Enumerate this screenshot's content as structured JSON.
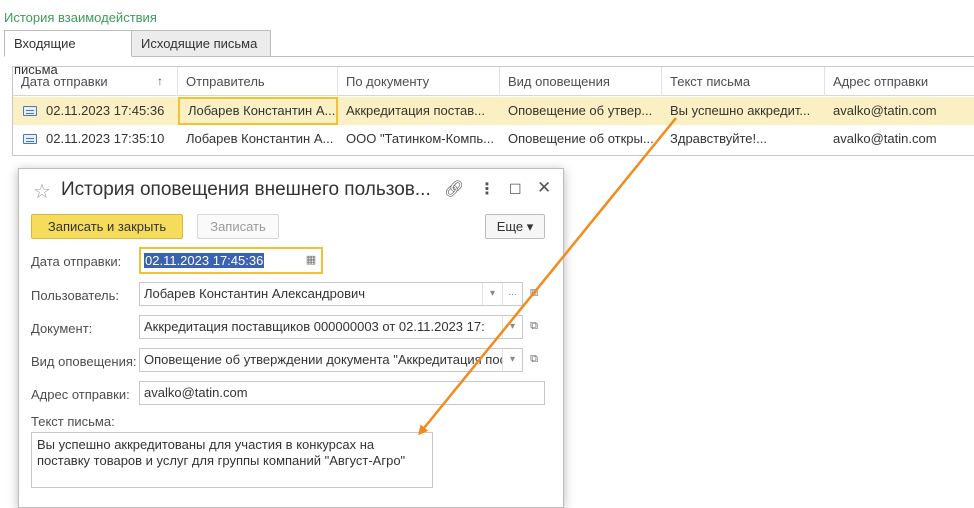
{
  "section_title": "История взаимодействия",
  "tabs": [
    {
      "label": "Входящие письма",
      "active": true
    },
    {
      "label": "Исходящие письма",
      "active": false
    }
  ],
  "table": {
    "columns": [
      "Дата отправки",
      "Отправитель",
      "По документу",
      "Вид оповещения",
      "Текст письма",
      "Адрес отправки"
    ],
    "sort_indicator": "↑",
    "rows": [
      {
        "date": "02.11.2023 17:45:36",
        "sender": "Лобарев Константин А...",
        "document": "Аккредитация постав...",
        "notice": "Оповещение об утвер...",
        "text": "Вы успешно аккредит...",
        "address": "avalko@tatin.com",
        "selected": true
      },
      {
        "date": "02.11.2023 17:35:10",
        "sender": "Лобарев Константин А...",
        "document": "ООО \"Татинком-Компь...",
        "notice": "Оповещение об откры...",
        "text": "Здравствуйте!...",
        "address": "avalko@tatin.com",
        "selected": false
      }
    ]
  },
  "dialog": {
    "title": "История оповещения внешнего пользов...",
    "buttons": {
      "save_close": "Записать и закрыть",
      "save": "Записать",
      "more": "Еще ▾"
    },
    "fields": {
      "date_label": "Дата отправки:",
      "date_value": "02.11.2023 17:45:36",
      "user_label": "Пользователь:",
      "user_value": "Лобарев Константин Александрович",
      "document_label": "Документ:",
      "document_value": "Аккредитация поставщиков 000000003 от 02.11.2023 17:",
      "notice_label": "Вид оповещения:",
      "notice_value": "Оповещение об утверждении документа \"Аккредитация пос",
      "address_label": "Адрес отправки:",
      "address_value": "avalko@tatin.com",
      "text_label": "Текст письма:",
      "text_value": "Вы успешно аккредитованы для участия в конкурсах на поставку товаров и услуг для группы компаний \"Август-Агро\""
    }
  },
  "colors": {
    "accent_yellow": "#f6dc5c",
    "focus_border": "#f1c232",
    "arrow": "#f28a1e",
    "title_green": "#3e9a5a",
    "row_selected": "#fbf0c3"
  }
}
